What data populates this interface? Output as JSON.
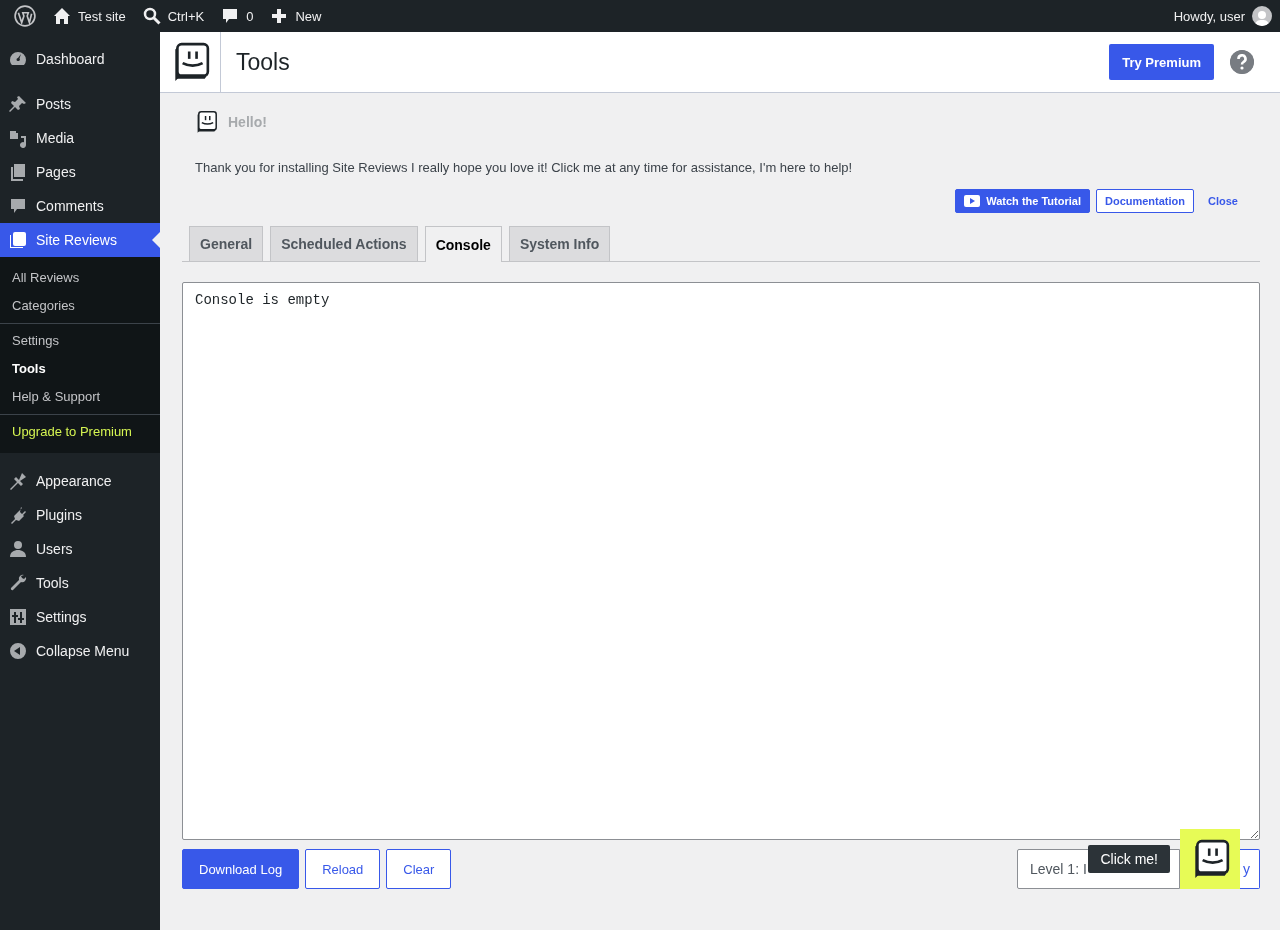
{
  "admin_bar": {
    "items": [
      {
        "kind": "wp-logo"
      },
      {
        "kind": "home",
        "label": "Test site"
      },
      {
        "kind": "search",
        "label": "Ctrl+K"
      },
      {
        "kind": "comments",
        "label": "0"
      },
      {
        "kind": "new",
        "label": "New"
      }
    ],
    "greeting": "Howdy, user"
  },
  "sidebar": {
    "groups": [
      [
        {
          "label": "Dashboard",
          "selected": false
        }
      ],
      [
        {
          "label": "Posts",
          "selected": false
        },
        {
          "label": "Media",
          "selected": false
        },
        {
          "label": "Pages",
          "selected": false
        },
        {
          "label": "Comments",
          "selected": false
        },
        {
          "label": "Site Reviews",
          "selected": true,
          "submenu": [
            [
              {
                "label": "All Reviews",
                "selected": false,
                "kind": "link"
              },
              {
                "label": "Categories",
                "selected": false,
                "kind": "link"
              }
            ],
            [
              {
                "label": "Settings",
                "selected": false,
                "kind": "link"
              },
              {
                "label": "Tools",
                "selected": true,
                "kind": "link"
              },
              {
                "label": "Help & Support",
                "selected": false,
                "kind": "link"
              }
            ],
            [
              {
                "label": "Upgrade to Premium",
                "selected": false,
                "kind": "upgrade"
              }
            ]
          ]
        }
      ],
      [
        {
          "label": "Appearance",
          "selected": false
        },
        {
          "label": "Plugins",
          "selected": false
        },
        {
          "label": "Users",
          "selected": false
        },
        {
          "label": "Tools",
          "selected": false
        },
        {
          "label": "Settings",
          "selected": false
        },
        {
          "label": "Collapse Menu",
          "selected": false
        }
      ]
    ]
  },
  "header": {
    "title": "Tools",
    "button": "Try Premium"
  },
  "notice": {
    "title": "Hello!",
    "message": "Thank you for installing Site Reviews I really hope you love it! Click me at any time for assistance, I'm here to help!",
    "buttons": [
      {
        "kind": "video",
        "label": "Watch the Tutorial"
      },
      {
        "kind": "secondary",
        "label": "Documentation"
      },
      {
        "kind": "link",
        "label": "Close"
      }
    ]
  },
  "tabs": [
    {
      "label": "General",
      "selected": false
    },
    {
      "label": "Scheduled Actions",
      "selected": false
    },
    {
      "label": "Console",
      "selected": true
    },
    {
      "label": "System Info",
      "selected": false
    }
  ],
  "console": {
    "value": "Console is empty"
  },
  "actions": [
    {
      "kind": "primary",
      "label": "Download Log"
    },
    {
      "kind": "secondary",
      "label": "Reload"
    },
    {
      "kind": "secondary",
      "label": "Clear"
    }
  ],
  "level_select": {
    "value": "Level 1: I"
  },
  "apply_button": {
    "label": "y"
  },
  "tooltip": "Click me!"
}
